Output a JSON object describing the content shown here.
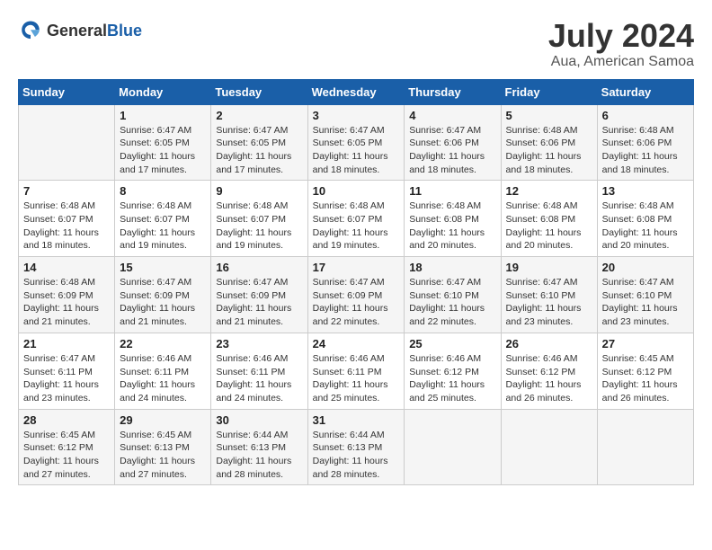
{
  "header": {
    "logo": {
      "general": "General",
      "blue": "Blue"
    },
    "title": "July 2024",
    "location": "Aua, American Samoa"
  },
  "days_of_week": [
    "Sunday",
    "Monday",
    "Tuesday",
    "Wednesday",
    "Thursday",
    "Friday",
    "Saturday"
  ],
  "weeks": [
    [
      {
        "day": "",
        "sunrise": "",
        "sunset": "",
        "daylight": ""
      },
      {
        "day": "1",
        "sunrise": "Sunrise: 6:47 AM",
        "sunset": "Sunset: 6:05 PM",
        "daylight": "Daylight: 11 hours and 17 minutes."
      },
      {
        "day": "2",
        "sunrise": "Sunrise: 6:47 AM",
        "sunset": "Sunset: 6:05 PM",
        "daylight": "Daylight: 11 hours and 17 minutes."
      },
      {
        "day": "3",
        "sunrise": "Sunrise: 6:47 AM",
        "sunset": "Sunset: 6:05 PM",
        "daylight": "Daylight: 11 hours and 18 minutes."
      },
      {
        "day": "4",
        "sunrise": "Sunrise: 6:47 AM",
        "sunset": "Sunset: 6:06 PM",
        "daylight": "Daylight: 11 hours and 18 minutes."
      },
      {
        "day": "5",
        "sunrise": "Sunrise: 6:48 AM",
        "sunset": "Sunset: 6:06 PM",
        "daylight": "Daylight: 11 hours and 18 minutes."
      },
      {
        "day": "6",
        "sunrise": "Sunrise: 6:48 AM",
        "sunset": "Sunset: 6:06 PM",
        "daylight": "Daylight: 11 hours and 18 minutes."
      }
    ],
    [
      {
        "day": "7",
        "sunrise": "Sunrise: 6:48 AM",
        "sunset": "Sunset: 6:07 PM",
        "daylight": "Daylight: 11 hours and 18 minutes."
      },
      {
        "day": "8",
        "sunrise": "Sunrise: 6:48 AM",
        "sunset": "Sunset: 6:07 PM",
        "daylight": "Daylight: 11 hours and 19 minutes."
      },
      {
        "day": "9",
        "sunrise": "Sunrise: 6:48 AM",
        "sunset": "Sunset: 6:07 PM",
        "daylight": "Daylight: 11 hours and 19 minutes."
      },
      {
        "day": "10",
        "sunrise": "Sunrise: 6:48 AM",
        "sunset": "Sunset: 6:07 PM",
        "daylight": "Daylight: 11 hours and 19 minutes."
      },
      {
        "day": "11",
        "sunrise": "Sunrise: 6:48 AM",
        "sunset": "Sunset: 6:08 PM",
        "daylight": "Daylight: 11 hours and 20 minutes."
      },
      {
        "day": "12",
        "sunrise": "Sunrise: 6:48 AM",
        "sunset": "Sunset: 6:08 PM",
        "daylight": "Daylight: 11 hours and 20 minutes."
      },
      {
        "day": "13",
        "sunrise": "Sunrise: 6:48 AM",
        "sunset": "Sunset: 6:08 PM",
        "daylight": "Daylight: 11 hours and 20 minutes."
      }
    ],
    [
      {
        "day": "14",
        "sunrise": "Sunrise: 6:48 AM",
        "sunset": "Sunset: 6:09 PM",
        "daylight": "Daylight: 11 hours and 21 minutes."
      },
      {
        "day": "15",
        "sunrise": "Sunrise: 6:47 AM",
        "sunset": "Sunset: 6:09 PM",
        "daylight": "Daylight: 11 hours and 21 minutes."
      },
      {
        "day": "16",
        "sunrise": "Sunrise: 6:47 AM",
        "sunset": "Sunset: 6:09 PM",
        "daylight": "Daylight: 11 hours and 21 minutes."
      },
      {
        "day": "17",
        "sunrise": "Sunrise: 6:47 AM",
        "sunset": "Sunset: 6:09 PM",
        "daylight": "Daylight: 11 hours and 22 minutes."
      },
      {
        "day": "18",
        "sunrise": "Sunrise: 6:47 AM",
        "sunset": "Sunset: 6:10 PM",
        "daylight": "Daylight: 11 hours and 22 minutes."
      },
      {
        "day": "19",
        "sunrise": "Sunrise: 6:47 AM",
        "sunset": "Sunset: 6:10 PM",
        "daylight": "Daylight: 11 hours and 23 minutes."
      },
      {
        "day": "20",
        "sunrise": "Sunrise: 6:47 AM",
        "sunset": "Sunset: 6:10 PM",
        "daylight": "Daylight: 11 hours and 23 minutes."
      }
    ],
    [
      {
        "day": "21",
        "sunrise": "Sunrise: 6:47 AM",
        "sunset": "Sunset: 6:11 PM",
        "daylight": "Daylight: 11 hours and 23 minutes."
      },
      {
        "day": "22",
        "sunrise": "Sunrise: 6:46 AM",
        "sunset": "Sunset: 6:11 PM",
        "daylight": "Daylight: 11 hours and 24 minutes."
      },
      {
        "day": "23",
        "sunrise": "Sunrise: 6:46 AM",
        "sunset": "Sunset: 6:11 PM",
        "daylight": "Daylight: 11 hours and 24 minutes."
      },
      {
        "day": "24",
        "sunrise": "Sunrise: 6:46 AM",
        "sunset": "Sunset: 6:11 PM",
        "daylight": "Daylight: 11 hours and 25 minutes."
      },
      {
        "day": "25",
        "sunrise": "Sunrise: 6:46 AM",
        "sunset": "Sunset: 6:12 PM",
        "daylight": "Daylight: 11 hours and 25 minutes."
      },
      {
        "day": "26",
        "sunrise": "Sunrise: 6:46 AM",
        "sunset": "Sunset: 6:12 PM",
        "daylight": "Daylight: 11 hours and 26 minutes."
      },
      {
        "day": "27",
        "sunrise": "Sunrise: 6:45 AM",
        "sunset": "Sunset: 6:12 PM",
        "daylight": "Daylight: 11 hours and 26 minutes."
      }
    ],
    [
      {
        "day": "28",
        "sunrise": "Sunrise: 6:45 AM",
        "sunset": "Sunset: 6:12 PM",
        "daylight": "Daylight: 11 hours and 27 minutes."
      },
      {
        "day": "29",
        "sunrise": "Sunrise: 6:45 AM",
        "sunset": "Sunset: 6:13 PM",
        "daylight": "Daylight: 11 hours and 27 minutes."
      },
      {
        "day": "30",
        "sunrise": "Sunrise: 6:44 AM",
        "sunset": "Sunset: 6:13 PM",
        "daylight": "Daylight: 11 hours and 28 minutes."
      },
      {
        "day": "31",
        "sunrise": "Sunrise: 6:44 AM",
        "sunset": "Sunset: 6:13 PM",
        "daylight": "Daylight: 11 hours and 28 minutes."
      },
      {
        "day": "",
        "sunrise": "",
        "sunset": "",
        "daylight": ""
      },
      {
        "day": "",
        "sunrise": "",
        "sunset": "",
        "daylight": ""
      },
      {
        "day": "",
        "sunrise": "",
        "sunset": "",
        "daylight": ""
      }
    ]
  ]
}
